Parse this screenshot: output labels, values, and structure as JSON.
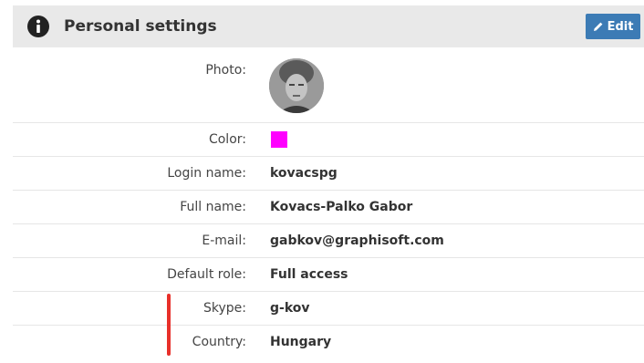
{
  "header": {
    "title": "Personal settings",
    "edit_label": "Edit"
  },
  "colors": {
    "header_bg": "#e9e9e9",
    "edit_button": "#3c7bb5",
    "user_color": "#ff00ff",
    "highlight": "#e8302a"
  },
  "fields": {
    "photo": {
      "label": "Photo:"
    },
    "color": {
      "label": "Color:",
      "value": "#ff00ff"
    },
    "login_name": {
      "label": "Login name:",
      "value": "kovacspg"
    },
    "full_name": {
      "label": "Full name:",
      "value": "Kovacs-Palko Gabor"
    },
    "email": {
      "label": "E-mail:",
      "value": "gabkov@graphisoft.com"
    },
    "default_role": {
      "label": "Default role:",
      "value": "Full access"
    },
    "skype": {
      "label": "Skype:",
      "value": "g-kov"
    },
    "country": {
      "label": "Country:",
      "value": "Hungary"
    }
  },
  "icons": {
    "header_icon": "info-icon",
    "edit_icon": "pencil-icon"
  }
}
